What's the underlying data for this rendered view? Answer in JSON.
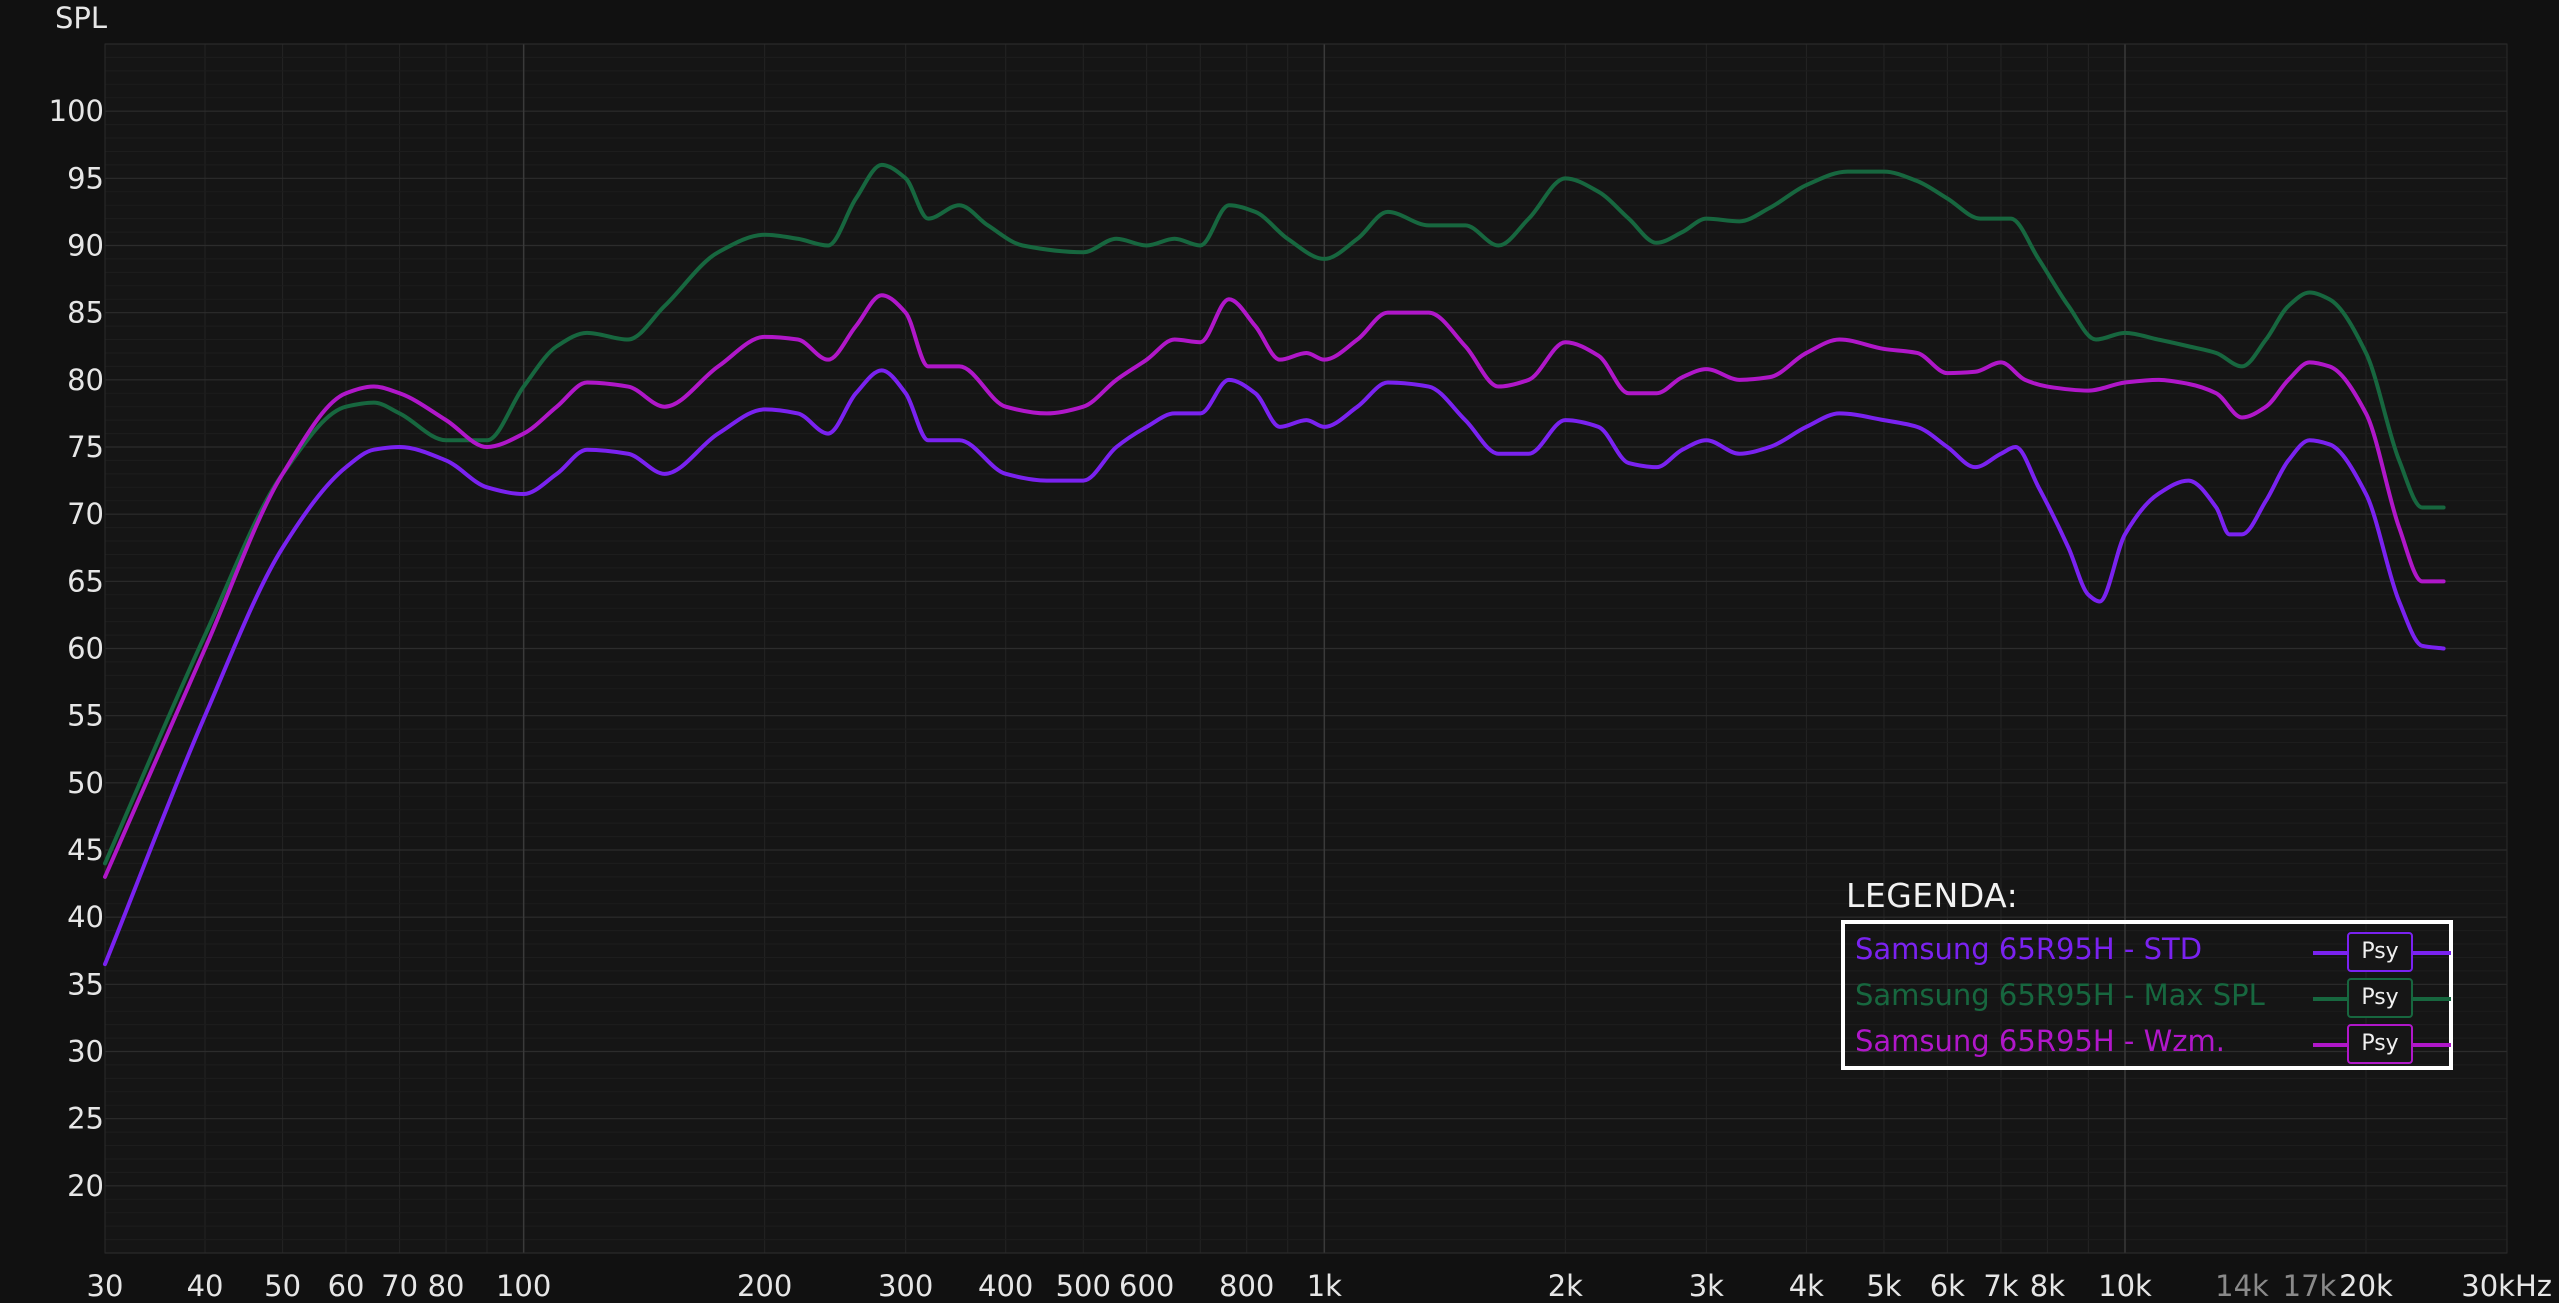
{
  "chart_data": {
    "type": "line",
    "ylabel": "SPL",
    "xunit": "Hz",
    "xscale": "log",
    "xlim": [
      30,
      30000
    ],
    "ylim": [
      15,
      105
    ],
    "grid": true,
    "y_ticks": [
      20,
      25,
      30,
      35,
      40,
      45,
      50,
      55,
      60,
      65,
      70,
      75,
      80,
      85,
      90,
      95,
      100
    ],
    "x_ticks": [
      {
        "v": 30,
        "label": "30",
        "dim": false
      },
      {
        "v": 40,
        "label": "40",
        "dim": false
      },
      {
        "v": 50,
        "label": "50",
        "dim": false
      },
      {
        "v": 60,
        "label": "60",
        "dim": false
      },
      {
        "v": 70,
        "label": "70",
        "dim": false
      },
      {
        "v": 80,
        "label": "80",
        "dim": false
      },
      {
        "v": 100,
        "label": "100",
        "dim": false
      },
      {
        "v": 200,
        "label": "200",
        "dim": false
      },
      {
        "v": 300,
        "label": "300",
        "dim": false
      },
      {
        "v": 400,
        "label": "400",
        "dim": false
      },
      {
        "v": 500,
        "label": "500",
        "dim": false
      },
      {
        "v": 600,
        "label": "600",
        "dim": false
      },
      {
        "v": 800,
        "label": "800",
        "dim": false
      },
      {
        "v": 1000,
        "label": "1k",
        "dim": false
      },
      {
        "v": 2000,
        "label": "2k",
        "dim": false
      },
      {
        "v": 3000,
        "label": "3k",
        "dim": false
      },
      {
        "v": 4000,
        "label": "4k",
        "dim": false
      },
      {
        "v": 5000,
        "label": "5k",
        "dim": false
      },
      {
        "v": 6000,
        "label": "6k",
        "dim": false
      },
      {
        "v": 7000,
        "label": "7k",
        "dim": false
      },
      {
        "v": 8000,
        "label": "8k",
        "dim": false
      },
      {
        "v": 10000,
        "label": "10k",
        "dim": false
      },
      {
        "v": 14000,
        "label": "14k",
        "dim": true
      },
      {
        "v": 17000,
        "label": "17k",
        "dim": true
      },
      {
        "v": 20000,
        "label": "20k",
        "dim": false
      },
      {
        "v": 30000,
        "label": "30kHz",
        "dim": false
      }
    ],
    "series": [
      {
        "name": "Samsung 65R95H - Max SPL",
        "color": "#17673f",
        "points": [
          [
            30,
            44
          ],
          [
            40,
            61
          ],
          [
            50,
            73
          ],
          [
            60,
            78
          ],
          [
            65,
            78.3
          ],
          [
            70,
            77.5
          ],
          [
            80,
            75.5
          ],
          [
            90,
            75.5
          ],
          [
            100,
            79.5
          ],
          [
            110,
            82.5
          ],
          [
            120,
            83.5
          ],
          [
            135,
            83
          ],
          [
            150,
            85.5
          ],
          [
            175,
            89.5
          ],
          [
            200,
            90.8
          ],
          [
            220,
            90.5
          ],
          [
            240,
            90
          ],
          [
            260,
            93.5
          ],
          [
            280,
            96
          ],
          [
            300,
            95
          ],
          [
            320,
            92
          ],
          [
            350,
            93
          ],
          [
            380,
            91.5
          ],
          [
            420,
            90
          ],
          [
            500,
            89.5
          ],
          [
            550,
            90.5
          ],
          [
            600,
            90
          ],
          [
            650,
            90.5
          ],
          [
            700,
            90
          ],
          [
            760,
            93
          ],
          [
            820,
            92.5
          ],
          [
            900,
            90.5
          ],
          [
            1000,
            89
          ],
          [
            1100,
            90.5
          ],
          [
            1200,
            92.5
          ],
          [
            1350,
            91.5
          ],
          [
            1500,
            91.5
          ],
          [
            1650,
            90
          ],
          [
            1800,
            92
          ],
          [
            2000,
            95
          ],
          [
            2200,
            94
          ],
          [
            2400,
            92
          ],
          [
            2600,
            90.2
          ],
          [
            2800,
            91
          ],
          [
            3000,
            92
          ],
          [
            3300,
            91.8
          ],
          [
            3600,
            92.8
          ],
          [
            4000,
            94.5
          ],
          [
            4500,
            95.5
          ],
          [
            5000,
            95.5
          ],
          [
            5500,
            94.8
          ],
          [
            6000,
            93.5
          ],
          [
            6600,
            92
          ],
          [
            7200,
            92
          ],
          [
            7800,
            89
          ],
          [
            8500,
            85.5
          ],
          [
            9200,
            83
          ],
          [
            10000,
            83.5
          ],
          [
            11000,
            83
          ],
          [
            12000,
            82.5
          ],
          [
            13000,
            82
          ],
          [
            14000,
            81
          ],
          [
            15000,
            83
          ],
          [
            16000,
            85.5
          ],
          [
            17000,
            86.5
          ],
          [
            18000,
            86
          ],
          [
            20000,
            82
          ],
          [
            22000,
            74
          ],
          [
            23500,
            70.5
          ],
          [
            25000,
            70.5
          ]
        ]
      },
      {
        "name": "Samsung 65R95H - Wzm.",
        "color": "#b017c9",
        "points": [
          [
            30,
            43
          ],
          [
            40,
            60
          ],
          [
            50,
            73
          ],
          [
            60,
            79
          ],
          [
            65,
            79.5
          ],
          [
            70,
            79
          ],
          [
            80,
            77
          ],
          [
            90,
            75
          ],
          [
            100,
            76
          ],
          [
            110,
            78
          ],
          [
            120,
            79.8
          ],
          [
            135,
            79.5
          ],
          [
            150,
            78
          ],
          [
            175,
            81
          ],
          [
            200,
            83.2
          ],
          [
            220,
            83
          ],
          [
            240,
            81.5
          ],
          [
            260,
            84
          ],
          [
            280,
            86.3
          ],
          [
            300,
            85
          ],
          [
            320,
            81
          ],
          [
            350,
            81
          ],
          [
            400,
            78
          ],
          [
            450,
            77.5
          ],
          [
            500,
            78
          ],
          [
            550,
            80
          ],
          [
            600,
            81.5
          ],
          [
            650,
            83
          ],
          [
            700,
            82.8
          ],
          [
            760,
            86
          ],
          [
            820,
            84
          ],
          [
            880,
            81.5
          ],
          [
            950,
            82
          ],
          [
            1000,
            81.5
          ],
          [
            1100,
            83
          ],
          [
            1200,
            85
          ],
          [
            1350,
            85
          ],
          [
            1500,
            82.5
          ],
          [
            1650,
            79.5
          ],
          [
            1800,
            80
          ],
          [
            2000,
            82.8
          ],
          [
            2200,
            81.8
          ],
          [
            2400,
            79
          ],
          [
            2600,
            79
          ],
          [
            2800,
            80.2
          ],
          [
            3000,
            80.8
          ],
          [
            3300,
            80
          ],
          [
            3600,
            80.2
          ],
          [
            4000,
            82
          ],
          [
            4400,
            83
          ],
          [
            5000,
            82.3
          ],
          [
            5500,
            82
          ],
          [
            6000,
            80.5
          ],
          [
            6500,
            80.6
          ],
          [
            7000,
            81.3
          ],
          [
            7500,
            80
          ],
          [
            8000,
            79.5
          ],
          [
            9000,
            79.2
          ],
          [
            10000,
            79.8
          ],
          [
            11000,
            80
          ],
          [
            12000,
            79.7
          ],
          [
            13000,
            79
          ],
          [
            14000,
            77.2
          ],
          [
            15000,
            78
          ],
          [
            16000,
            80
          ],
          [
            17000,
            81.3
          ],
          [
            18000,
            81
          ],
          [
            20000,
            77.5
          ],
          [
            22000,
            69
          ],
          [
            23500,
            65
          ],
          [
            25000,
            65
          ]
        ]
      },
      {
        "name": "Samsung 65R95H - STD",
        "color": "#7a22f0",
        "points": [
          [
            30,
            36.5
          ],
          [
            40,
            55
          ],
          [
            50,
            67.5
          ],
          [
            60,
            73.5
          ],
          [
            65,
            74.8
          ],
          [
            70,
            75
          ],
          [
            80,
            74
          ],
          [
            90,
            72
          ],
          [
            100,
            71.5
          ],
          [
            110,
            73
          ],
          [
            120,
            74.8
          ],
          [
            135,
            74.5
          ],
          [
            150,
            73
          ],
          [
            175,
            76
          ],
          [
            200,
            77.8
          ],
          [
            220,
            77.5
          ],
          [
            240,
            76
          ],
          [
            260,
            79
          ],
          [
            280,
            80.7
          ],
          [
            300,
            79
          ],
          [
            320,
            75.5
          ],
          [
            350,
            75.5
          ],
          [
            400,
            73
          ],
          [
            450,
            72.5
          ],
          [
            500,
            72.5
          ],
          [
            550,
            75
          ],
          [
            600,
            76.5
          ],
          [
            650,
            77.5
          ],
          [
            700,
            77.5
          ],
          [
            760,
            80
          ],
          [
            820,
            79
          ],
          [
            880,
            76.5
          ],
          [
            950,
            77
          ],
          [
            1000,
            76.5
          ],
          [
            1100,
            78
          ],
          [
            1200,
            79.8
          ],
          [
            1350,
            79.5
          ],
          [
            1500,
            77
          ],
          [
            1650,
            74.5
          ],
          [
            1800,
            74.5
          ],
          [
            2000,
            77
          ],
          [
            2200,
            76.5
          ],
          [
            2400,
            73.8
          ],
          [
            2600,
            73.5
          ],
          [
            2800,
            74.8
          ],
          [
            3000,
            75.5
          ],
          [
            3300,
            74.5
          ],
          [
            3600,
            75
          ],
          [
            4000,
            76.5
          ],
          [
            4400,
            77.5
          ],
          [
            5000,
            77
          ],
          [
            5500,
            76.5
          ],
          [
            6000,
            75
          ],
          [
            6500,
            73.5
          ],
          [
            7000,
            74.5
          ],
          [
            7300,
            75
          ],
          [
            7800,
            72
          ],
          [
            8500,
            67.5
          ],
          [
            9000,
            64
          ],
          [
            9300,
            63.5
          ],
          [
            10000,
            68.5
          ],
          [
            11000,
            71.5
          ],
          [
            12000,
            72.5
          ],
          [
            13000,
            70.5
          ],
          [
            13500,
            68.5
          ],
          [
            14000,
            68.5
          ],
          [
            15000,
            71
          ],
          [
            16000,
            74
          ],
          [
            17000,
            75.5
          ],
          [
            18000,
            75.2
          ],
          [
            20000,
            71.5
          ],
          [
            22000,
            63.5
          ],
          [
            23500,
            60.2
          ],
          [
            25000,
            60
          ]
        ]
      }
    ]
  },
  "legend": {
    "title": "LEGENDA:",
    "items": [
      {
        "label": "Samsung 65R95H - STD",
        "color": "#7a22f0",
        "psy": "Psy"
      },
      {
        "label": "Samsung 65R95H - Max SPL",
        "color": "#17673f",
        "psy": "Psy"
      },
      {
        "label": "Samsung 65R95H - Wzm.",
        "color": "#b017c9",
        "psy": "Psy"
      }
    ]
  }
}
